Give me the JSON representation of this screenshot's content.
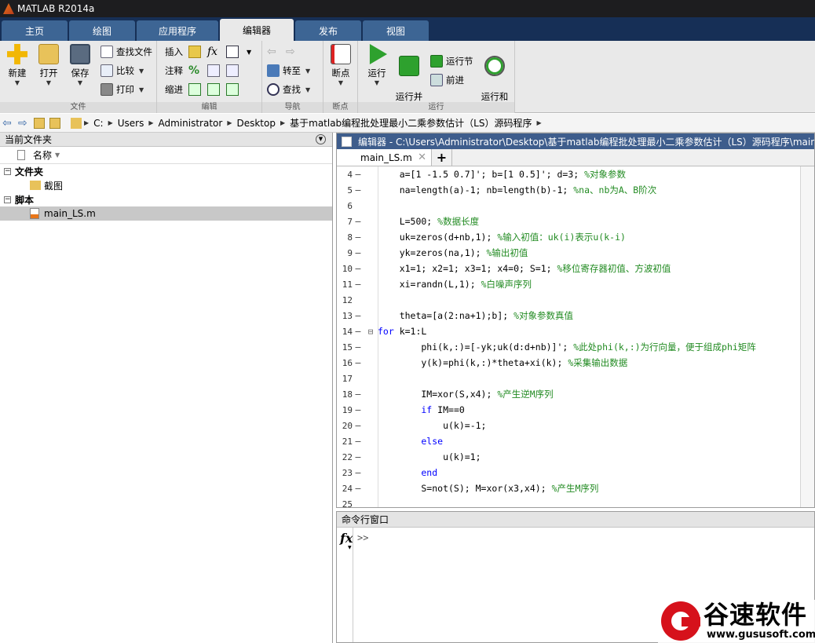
{
  "window": {
    "title": "MATLAB R2014a"
  },
  "tabs": [
    {
      "label": "主页"
    },
    {
      "label": "绘图"
    },
    {
      "label": "应用程序"
    },
    {
      "label": "编辑器",
      "active": true
    },
    {
      "label": "发布"
    },
    {
      "label": "视图"
    }
  ],
  "ribbon": {
    "file": {
      "group_label": "文件",
      "new": "新建",
      "open": "打开",
      "save": "保存",
      "find_files": "查找文件",
      "compare": "比较",
      "print": "打印"
    },
    "edit": {
      "group_label": "编辑",
      "insert": "插入",
      "fx": "fx",
      "comment": "注释",
      "percent": "%",
      "indent": "缩进"
    },
    "navigate": {
      "group_label": "导航",
      "goto": "转至",
      "find": "查找"
    },
    "breakpoints": {
      "group_label": "断点",
      "breakpoints": "断点"
    },
    "run": {
      "group_label": "运行",
      "run": "运行",
      "run_advance": "运行并\n前进",
      "run_section": "运行节",
      "advance": "前进",
      "run_time": "运行和\n计时"
    }
  },
  "address": {
    "crumbs": [
      "C:",
      "Users",
      "Administrator",
      "Desktop",
      "基于matlab编程批处理最小二乘参数估计（LS）源码程序"
    ]
  },
  "current_folder": {
    "title": "当前文件夹",
    "column_name": "名称",
    "groups": [
      {
        "label": "文件夹",
        "items": [
          "截图"
        ]
      },
      {
        "label": "脚本",
        "items": [
          "main_LS.m"
        ]
      }
    ]
  },
  "editor": {
    "title": "编辑器 - C:\\Users\\Administrator\\Desktop\\基于matlab编程批处理最小二乘参数估计（LS）源码程序\\main_",
    "tab": "main_LS.m",
    "add_tab": "+",
    "lines": [
      {
        "n": "4",
        "dash": "–",
        "fold": "",
        "code": "    a=[1 -1.5 0.7]'; b=[1 0.5]'; d=3; ",
        "comment": "%对象参数"
      },
      {
        "n": "5",
        "dash": "–",
        "fold": "",
        "code": "    na=length(a)-1; nb=length(b)-1; ",
        "comment": "%na、nb为A、B阶次"
      },
      {
        "n": "6",
        "dash": "",
        "fold": "",
        "code": "",
        "comment": ""
      },
      {
        "n": "7",
        "dash": "–",
        "fold": "",
        "code": "    L=500; ",
        "comment": "%数据长度"
      },
      {
        "n": "8",
        "dash": "–",
        "fold": "",
        "code": "    uk=zeros(d+nb,1); ",
        "comment": "%输入初值：uk(i)表示u(k-i)"
      },
      {
        "n": "9",
        "dash": "–",
        "fold": "",
        "code": "    yk=zeros(na,1); ",
        "comment": "%输出初值"
      },
      {
        "n": "10",
        "dash": "–",
        "fold": "",
        "code": "    x1=1; x2=1; x3=1; x4=0; S=1; ",
        "comment": "%移位寄存器初值、方波初值"
      },
      {
        "n": "11",
        "dash": "–",
        "fold": "",
        "code": "    xi=randn(L,1); ",
        "comment": "%白噪声序列"
      },
      {
        "n": "12",
        "dash": "",
        "fold": "",
        "code": "",
        "comment": ""
      },
      {
        "n": "13",
        "dash": "–",
        "fold": "",
        "code": "    theta=[a(2:na+1);b]; ",
        "comment": "%对象参数真值"
      },
      {
        "n": "14",
        "dash": "–",
        "fold": "⊟",
        "kw": "for",
        "code": " k=1:L",
        "comment": ""
      },
      {
        "n": "15",
        "dash": "–",
        "fold": "",
        "code": "        phi(k,:)=[-yk;uk(d:d+nb)]'; ",
        "comment": "%此处phi(k,:)为行向量，便于组成phi矩阵"
      },
      {
        "n": "16",
        "dash": "–",
        "fold": "",
        "code": "        y(k)=phi(k,:)*theta+xi(k); ",
        "comment": "%采集输出数据"
      },
      {
        "n": "17",
        "dash": "",
        "fold": "",
        "code": "",
        "comment": ""
      },
      {
        "n": "18",
        "dash": "–",
        "fold": "",
        "code": "        IM=xor(S,x4); ",
        "comment": "%产生逆M序列"
      },
      {
        "n": "19",
        "dash": "–",
        "fold": "",
        "kw": "        if",
        "code": " IM==0",
        "comment": ""
      },
      {
        "n": "20",
        "dash": "–",
        "fold": "",
        "code": "            u(k)=-1;",
        "comment": ""
      },
      {
        "n": "21",
        "dash": "–",
        "fold": "",
        "kw": "        else",
        "code": "",
        "comment": ""
      },
      {
        "n": "22",
        "dash": "–",
        "fold": "",
        "code": "            u(k)=1;",
        "comment": ""
      },
      {
        "n": "23",
        "dash": "–",
        "fold": "",
        "kw": "        end",
        "code": "",
        "comment": ""
      },
      {
        "n": "24",
        "dash": "–",
        "fold": "",
        "code": "        S=not(S); M=xor(x3,x4); ",
        "comment": "%产生M序列"
      },
      {
        "n": "25",
        "dash": "",
        "fold": "",
        "code": "",
        "comment": ""
      }
    ]
  },
  "command_window": {
    "title": "命令行窗口",
    "fx": "fx",
    "prompt": ">>"
  },
  "watermark": {
    "brand_cn": "谷速软件",
    "url": "www.gususoft.com"
  },
  "colors": {
    "tabbar": "#162f56",
    "tab": "#3d6594",
    "editor_header": "#3e5d8c",
    "comment": "#228b22",
    "keyword": "#0000ff",
    "brand_red": "#d6111b"
  }
}
